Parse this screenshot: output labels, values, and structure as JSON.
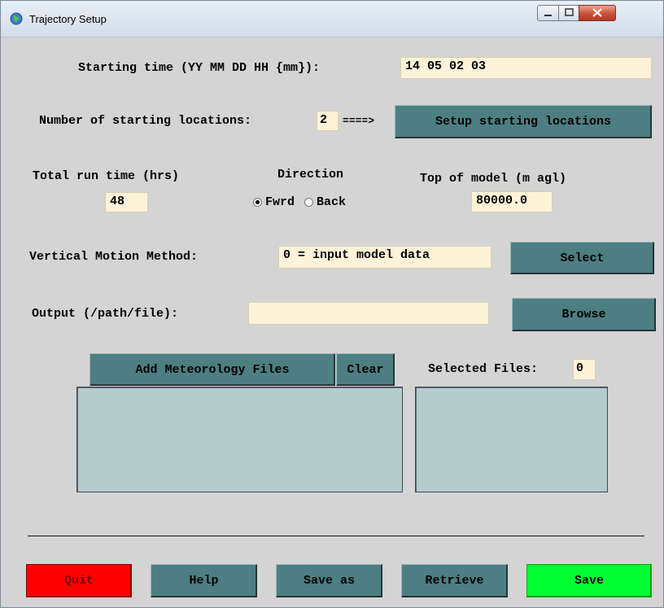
{
  "window": {
    "title": "Trajectory Setup"
  },
  "starting_time": {
    "label": "Starting time (YY MM DD HH {mm}):",
    "value": "14 05 02 03"
  },
  "locations": {
    "label": "Number of starting locations:",
    "count": "2",
    "arrow": "====>",
    "setup_button": "Setup starting locations"
  },
  "run_time": {
    "label": "Total run time (hrs)",
    "value": "48"
  },
  "direction": {
    "label": "Direction",
    "options": [
      "Fwrd",
      "Back"
    ],
    "selected": "Fwrd"
  },
  "top_model": {
    "label": "Top of model (m agl)",
    "value": "80000.0"
  },
  "vertical_motion": {
    "label": "Vertical Motion Method:",
    "value": "0 = input model data",
    "button": "Select"
  },
  "output": {
    "label": "Output (/path/file):",
    "value": "",
    "button": "Browse"
  },
  "meteorology": {
    "add_button": "Add Meteorology Files",
    "clear_button": "Clear",
    "selected_label": "Selected Files:",
    "selected_count": "0"
  },
  "footer": {
    "quit": "Quit",
    "help": "Help",
    "save_as": "Save as",
    "retrieve": "Retrieve",
    "save": "Save"
  },
  "colors": {
    "button_teal": "#4d7e82",
    "field_bg": "#fdf3d8",
    "listbox_bg": "#b3cccc",
    "quit_red": "#ff0000",
    "save_green": "#00ff33"
  }
}
